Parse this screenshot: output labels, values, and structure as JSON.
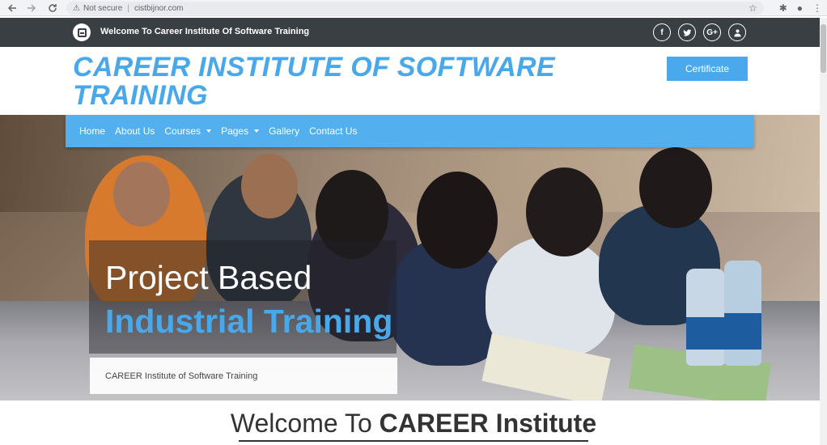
{
  "browser": {
    "back_icon": "arrow-left",
    "forward_icon": "arrow-right",
    "reload_icon": "reload",
    "security_label": "Not secure",
    "url": "cistbijnor.com"
  },
  "topbar": {
    "welcome": "Welcome To Career Institute Of Software Training",
    "socials": [
      {
        "name": "facebook",
        "glyph": "f"
      },
      {
        "name": "twitter",
        "glyph": "t"
      },
      {
        "name": "google-plus",
        "glyph": "G+"
      },
      {
        "name": "user",
        "glyph": "user"
      }
    ]
  },
  "header": {
    "title": "CAREER INSTITUTE OF SOFTWARE TRAINING",
    "certificate_label": "Certificate"
  },
  "nav": {
    "items": [
      {
        "label": "Home",
        "dropdown": false
      },
      {
        "label": "About Us",
        "dropdown": false
      },
      {
        "label": "Courses",
        "dropdown": true
      },
      {
        "label": "Pages",
        "dropdown": true
      },
      {
        "label": "Gallery",
        "dropdown": false
      },
      {
        "label": "Contact Us",
        "dropdown": false
      }
    ]
  },
  "hero": {
    "line1": "Project Based",
    "line2": "Industrial Training",
    "subtitle": "CAREER Institute of Software Training"
  },
  "welcome": {
    "thin": "Welcome To ",
    "bold": "CAREER Institute"
  },
  "colors": {
    "accent": "#49a8ea",
    "topbar": "#3a3f44",
    "nav": "#54afef"
  }
}
